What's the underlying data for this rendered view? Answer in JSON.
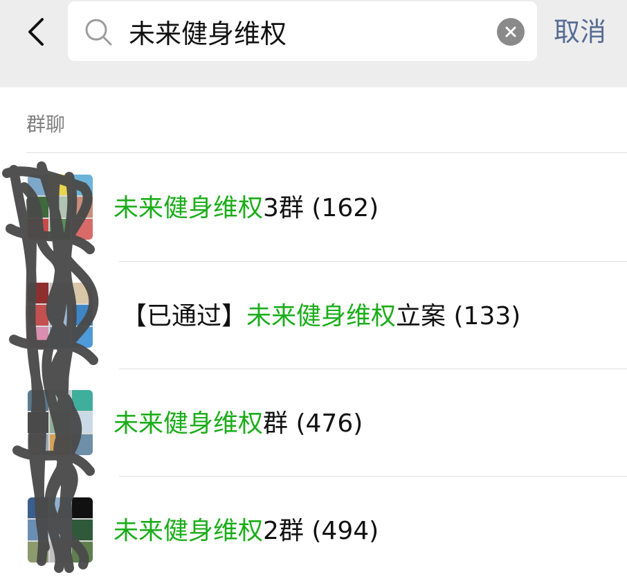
{
  "header": {
    "back_icon": "chevron-left-icon",
    "search_icon": "search-icon",
    "search_value": "未来健身维权",
    "clear_icon": "clear-icon",
    "cancel_label": "取消"
  },
  "section": {
    "title": "群聊"
  },
  "results": [
    {
      "prefix": "",
      "highlight": "未来健身维权",
      "suffix": "3群",
      "count": "(162)"
    },
    {
      "prefix": "【已通过】",
      "highlight": "未来健身维权",
      "suffix": "立案",
      "count": "(133)"
    },
    {
      "prefix": "",
      "highlight": "未来健身维权",
      "suffix": "群",
      "count": "(476)"
    },
    {
      "prefix": "",
      "highlight": "未来健身维权",
      "suffix": "2群",
      "count": "(494)"
    }
  ],
  "colors": {
    "highlight": "#1aad19",
    "cancel": "#576b95",
    "topbar": "#ededed"
  }
}
